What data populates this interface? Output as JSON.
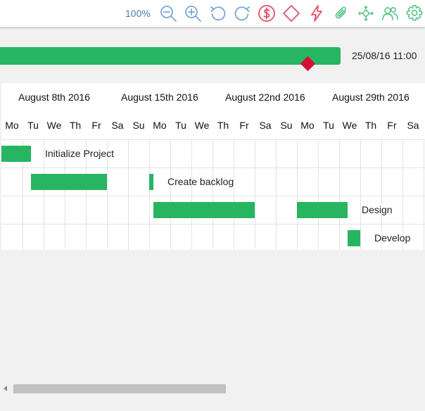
{
  "toolbar": {
    "zoom_level": "100%",
    "icons": [
      {
        "name": "zoom-out-icon",
        "color": "#7aa7d6"
      },
      {
        "name": "zoom-in-icon",
        "color": "#7aa7d6"
      },
      {
        "name": "undo-icon",
        "color": "#7aa7d6"
      },
      {
        "name": "redo-icon",
        "color": "#7aa7d6"
      },
      {
        "name": "dollar-icon",
        "color": "#e2516b"
      },
      {
        "name": "diamond-icon",
        "color": "#e2516b"
      },
      {
        "name": "lightning-icon",
        "color": "#e2516b"
      },
      {
        "name": "paperclip-icon",
        "color": "#5fc78a"
      },
      {
        "name": "network-icon",
        "color": "#5fc78a"
      },
      {
        "name": "users-icon",
        "color": "#5fc78a"
      },
      {
        "name": "gear-icon",
        "color": "#5fc78a"
      }
    ]
  },
  "summary": {
    "date_label": "25/08/16 11:00",
    "bar_color": "#27b562",
    "milestone_color": "#d90d3a"
  },
  "timeline": {
    "weeks": [
      "August 8th 2016",
      "August 15th 2016",
      "August 22nd 2016",
      "August 29th 2016"
    ],
    "days": [
      "Mo",
      "Tu",
      "We",
      "Th",
      "Fr",
      "Sa",
      "Su",
      "Mo",
      "Tu",
      "We",
      "Th",
      "Fr",
      "Sa",
      "Su",
      "Mo",
      "Tu",
      "We",
      "Th",
      "Fr",
      "Sa"
    ]
  },
  "tasks": [
    {
      "label": "Initialize Project"
    },
    {
      "label": "Create backlog"
    },
    {
      "label": "Design"
    },
    {
      "label": "Develop"
    }
  ]
}
